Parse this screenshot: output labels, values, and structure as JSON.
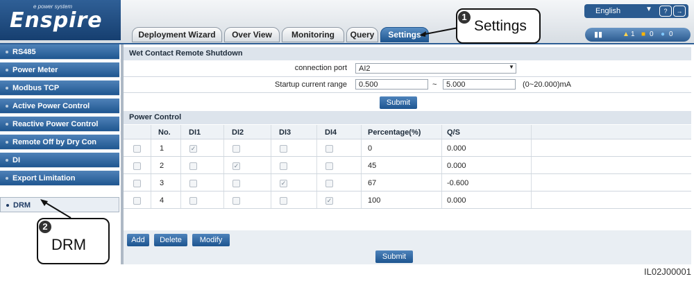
{
  "logo": {
    "tagline": "e power system",
    "name": "Enspire"
  },
  "tabs": [
    "Deployment Wizard",
    "Over View",
    "Monitoring",
    "Query",
    "Settings"
  ],
  "language": {
    "selected": "English"
  },
  "status": {
    "alarm_major": "1",
    "alarm_minor": "0",
    "alarm_warning": "0"
  },
  "sidebar": {
    "items": [
      {
        "label": "RS485"
      },
      {
        "label": "Power Meter"
      },
      {
        "label": "Modbus TCP"
      },
      {
        "label": "Active Power Control"
      },
      {
        "label": "Reactive Power Control"
      },
      {
        "label": "Remote Off by Dry Con"
      },
      {
        "label": "DI"
      },
      {
        "label": "Export Limitation"
      },
      {
        "label": "DRM"
      }
    ]
  },
  "wet_contact": {
    "title": "Wet Contact Remote Shutdown",
    "port_label": "connection port",
    "port_value": "AI2",
    "range_label": "Startup current range",
    "range_min": "0.500",
    "range_sep": "~",
    "range_max": "5.000",
    "range_hint": "(0~20.000)mA",
    "submit_label": "Submit"
  },
  "power_control": {
    "title": "Power Control",
    "columns": [
      "No.",
      "DI1",
      "DI2",
      "DI3",
      "DI4",
      "Percentage(%)",
      "Q/S"
    ],
    "rows": [
      {
        "no": "1",
        "di": [
          true,
          false,
          false,
          false
        ],
        "pct": "0",
        "qs": "0.000"
      },
      {
        "no": "2",
        "di": [
          false,
          true,
          false,
          false
        ],
        "pct": "45",
        "qs": "0.000"
      },
      {
        "no": "3",
        "di": [
          false,
          false,
          true,
          false
        ],
        "pct": "67",
        "qs": "-0.600"
      },
      {
        "no": "4",
        "di": [
          false,
          false,
          false,
          true
        ],
        "pct": "100",
        "qs": "0.000"
      }
    ],
    "add_label": "Add",
    "delete_label": "Delete",
    "modify_label": "Modify",
    "submit_label": "Submit"
  },
  "callouts": {
    "settings": {
      "num": "1",
      "text": "Settings"
    },
    "drm": {
      "num": "2",
      "text": "DRM"
    }
  },
  "figure_id": "IL02J00001"
}
